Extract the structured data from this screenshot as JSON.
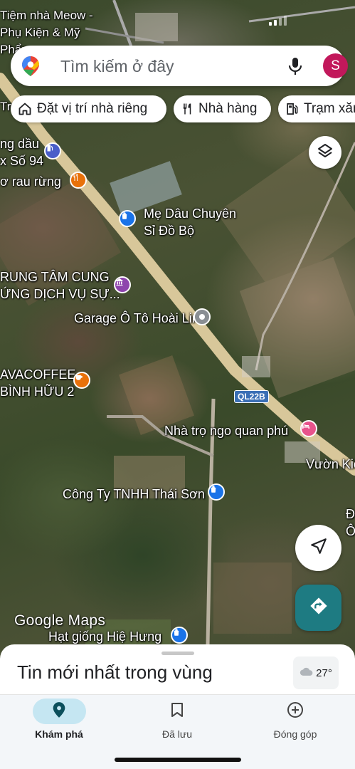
{
  "top_business": {
    "name": "Tiệm nhà Meow - Phụ Kiện & Mỹ Phẩm"
  },
  "search": {
    "placeholder": "Tìm kiếm ở đây",
    "avatar_letter": "S"
  },
  "chips": [
    {
      "label": "Đặt vị trí nhà riêng",
      "icon": "home-icon"
    },
    {
      "label": "Nhà hàng",
      "icon": "restaurant-icon"
    },
    {
      "label": "Trạm xăng",
      "icon": "gas-station-icon"
    }
  ],
  "places": {
    "fuel": "ng dầu",
    "lottery": "x Số 94",
    "restaurant": "ơ rau rừng",
    "me_dau": "Mẹ Dâu Chuyên Sỉ Đồ Bộ",
    "trung_tam_1": "RUNG TÂM CUNG",
    "trung_tam_2": "ỨNG DỊCH VỤ SỰ...",
    "garage": "Garage Ô Tô Hoài Linh",
    "cafe_1": "AVACOFFEE",
    "cafe_2": "BÌNH HỮU 2",
    "road_shield": "QL22B",
    "nha_tro": "Nhà trọ ngo quan phú",
    "vuon": "Vườn Kiể",
    "cong_ty": "Công Ty TNHH Thái Sơn",
    "right_edge_1": "Đ",
    "right_edge_2": "Ô",
    "hat_giong": "Hạt giống Hiệ Hưng",
    "left_top": "Trư"
  },
  "google_logo": "Google Maps",
  "sheet": {
    "title": "Tin mới nhất trong vùng",
    "weather": "27°"
  },
  "nav": [
    {
      "label": "Khám phá",
      "icon": "explore-pin-icon",
      "active": true
    },
    {
      "label": "Đã lưu",
      "icon": "bookmark-icon",
      "active": false
    },
    {
      "label": "Đóng góp",
      "icon": "add-circle-icon",
      "active": false
    }
  ],
  "colors": {
    "accent": "#1e7b82",
    "avatar": "#c2185b",
    "shopping_pin": "#1a73e8",
    "food_pin": "#e8710a",
    "lodging_pin": "#e8538c",
    "landmark_pin": "#8e44ad",
    "gas_pin": "#4a5ec9"
  }
}
